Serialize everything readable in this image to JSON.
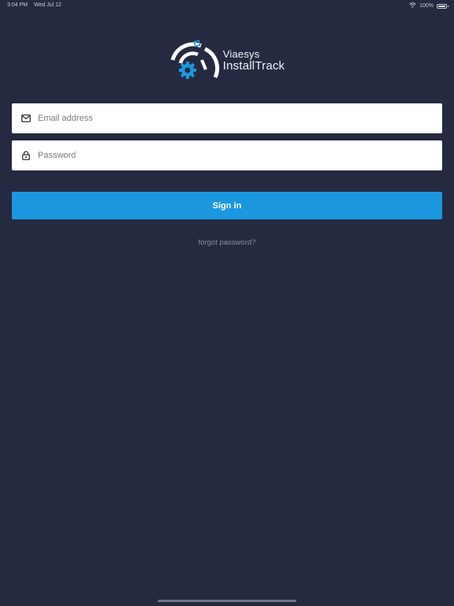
{
  "status_bar": {
    "time": "3:04 PM",
    "date": "Wed Jul 12",
    "battery": "100%",
    "icons": [
      "wifi-icon",
      "battery-icon"
    ]
  },
  "brand": {
    "line1": "Viaesys",
    "line2": "InstallTrack",
    "accent_color": "#1b97e0",
    "icon": "gear-gauge-logo"
  },
  "login": {
    "email_placeholder": "Email address",
    "email_value": "",
    "email_icon": "envelope-icon",
    "password_placeholder": "Password",
    "password_value": "",
    "password_icon": "lock-icon",
    "sign_in_label": "Sign in",
    "forgot_label": "forgot password?"
  },
  "colors": {
    "background": "#252a41",
    "button": "#1b97e0"
  }
}
